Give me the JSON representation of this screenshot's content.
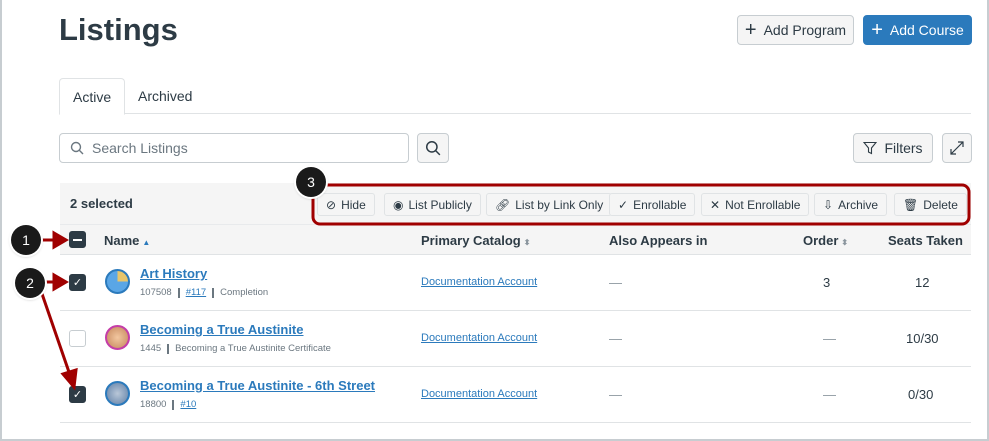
{
  "header": {
    "title": "Listings",
    "add_program": "Add Program",
    "add_course": "Add Course"
  },
  "tabs": [
    {
      "label": "Active",
      "selected": true
    },
    {
      "label": "Archived",
      "selected": false
    }
  ],
  "search": {
    "placeholder": "Search Listings",
    "value": ""
  },
  "toolbar": {
    "filters": "Filters"
  },
  "bulk": {
    "selected_text": "2 selected",
    "actions": [
      "Hide",
      "List Publicly",
      "List by Link Only",
      "Enrollable",
      "Not Enrollable",
      "Archive",
      "Delete"
    ]
  },
  "columns": {
    "name": "Name",
    "primary_catalog": "Primary Catalog",
    "also_appears": "Also Appears in",
    "order": "Order",
    "seats": "Seats Taken"
  },
  "rows": [
    {
      "name": "Art History",
      "id": "107508",
      "ref": "#117",
      "extra": "Completion",
      "catalog": "Documentation Account",
      "also": "—",
      "order": "3",
      "seats": "12",
      "checked": true
    },
    {
      "name": "Becoming a True Austinite",
      "id": "1445",
      "extra": "Becoming a True Austinite Certificate",
      "catalog": "Documentation Account",
      "also": "—",
      "order": "—",
      "seats": "10/30",
      "checked": false
    },
    {
      "name": "Becoming a True Austinite - 6th Street",
      "id": "18800",
      "ref": "#10",
      "catalog": "Documentation Account",
      "also": "—",
      "order": "—",
      "seats": "0/30",
      "checked": true
    }
  ],
  "callouts": [
    "1",
    "2",
    "3"
  ],
  "colors": {
    "accent": "#2b7abc",
    "callout_red": "#a00000"
  }
}
